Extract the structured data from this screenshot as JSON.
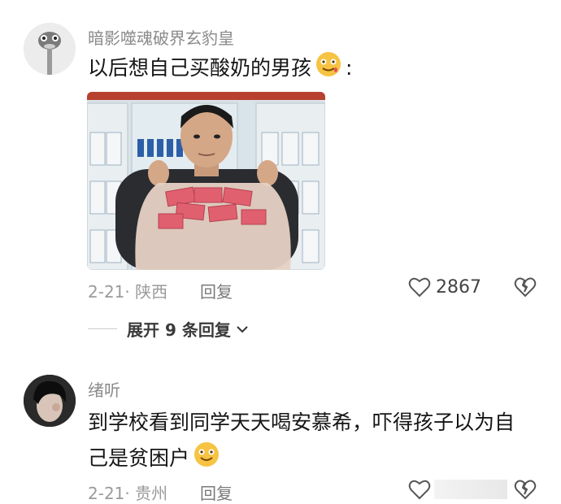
{
  "comments": [
    {
      "username": "暗影噬魂破界玄豹皇",
      "text": "以后想自己买酸奶的男孩",
      "text_suffix": ":",
      "date": "2-21",
      "region": "陕西",
      "reply_label": "回复",
      "likes": "2867",
      "expand_label": "展开 9 条回复"
    },
    {
      "username": "绪听",
      "text_line1": "到学校看到同学天天喝安慕希，吓得孩子以为自",
      "text_line2": "己是贫困户",
      "date": "2-21",
      "region": "贵州",
      "reply_label": "回复"
    }
  ],
  "colors": {
    "username": "#8a8a8a",
    "meta": "#9a9a9a",
    "divider": "#cccccc",
    "cash": "#e06070"
  }
}
